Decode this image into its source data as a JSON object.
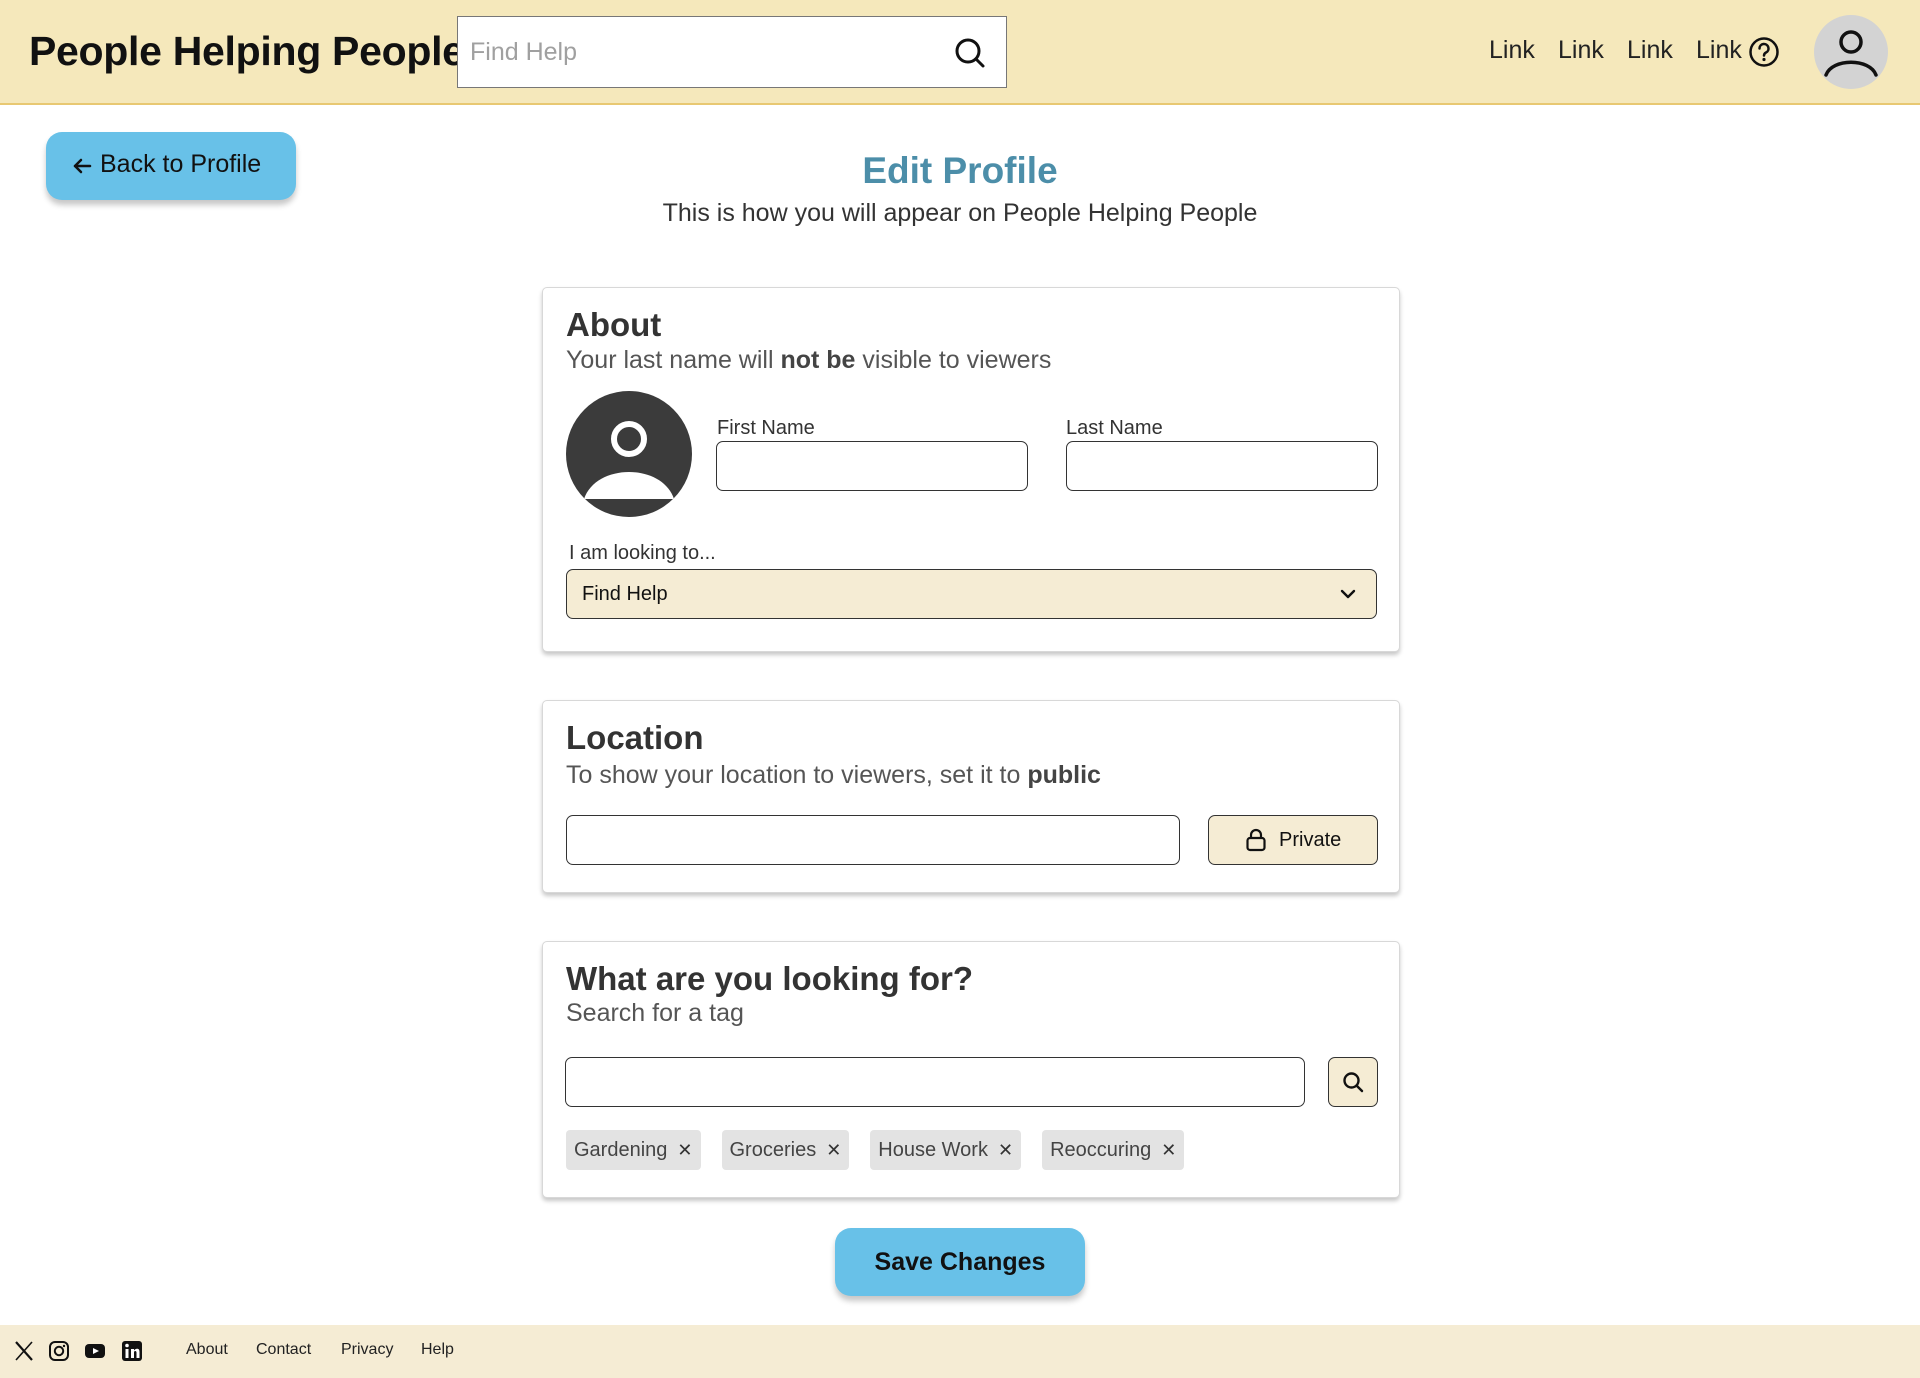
{
  "header": {
    "brand": "People Helping People",
    "search_placeholder": "Find Help",
    "nav_links": [
      "Link",
      "Link",
      "Link",
      "Link"
    ]
  },
  "back_button": {
    "label": "Back to Profile"
  },
  "page": {
    "title": "Edit Profile",
    "subtitle": "This is how you will appear on People Helping People"
  },
  "about": {
    "heading": "About",
    "desc_pre": "Your last name will ",
    "desc_bold": "not be",
    "desc_post": " visible to viewers",
    "first_name_label": "First Name",
    "first_name_value": "",
    "last_name_label": "Last Name",
    "last_name_value": "",
    "looking_label": "I am looking to...",
    "looking_value": "Find Help"
  },
  "location": {
    "heading": "Location",
    "desc_pre": "To show your location to viewers, set it to ",
    "desc_bold": "public",
    "value": "",
    "privacy_label": "Private"
  },
  "tags_section": {
    "heading": "What are you looking for?",
    "desc": "Search for a tag",
    "search_value": "",
    "tags": [
      "Gardening",
      "Groceries",
      "House Work",
      "Reoccuring"
    ]
  },
  "save_button": {
    "label": "Save Changes"
  },
  "footer": {
    "links": [
      "About",
      "Contact",
      "Privacy",
      "Help"
    ],
    "social_icons": [
      "x-icon",
      "instagram-icon",
      "youtube-icon",
      "linkedin-icon"
    ]
  },
  "colors": {
    "header_bg": "#f5e8bb",
    "accent_button": "#68c1e8",
    "title": "#4c8ea9",
    "footer_bg": "#f5ecd4"
  }
}
